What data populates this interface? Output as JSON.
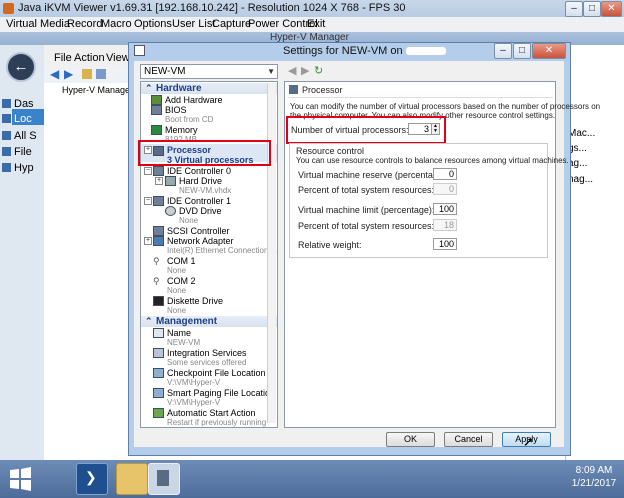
{
  "kvm": {
    "title": "Java iKVM Viewer v1.69.31 [192.168.10.242]  - Resolution 1024 X 768 - FPS 30",
    "menu": [
      "Virtual Media",
      "Record",
      "Macro",
      "Options",
      "User List",
      "Capture",
      "Power Control",
      "Exit"
    ]
  },
  "hyperv": {
    "title": "Hyper-V Manager",
    "menu": [
      "File",
      "Action",
      "View"
    ],
    "tree": [
      "Das",
      "Loc",
      "All S",
      "File",
      "Hyp"
    ],
    "pane_label": "Hyper-V Manager",
    "right_items": [
      "Mac...",
      "gs...",
      "ag...",
      "nag..."
    ]
  },
  "dialog": {
    "title": "Settings for NEW-VM on",
    "vm_selector": "NEW-VM",
    "hardware_header": "Hardware",
    "management_header": "Management",
    "hardware_items": [
      {
        "label": "Add Hardware",
        "sub": ""
      },
      {
        "label": "BIOS",
        "sub": "Boot from CD"
      },
      {
        "label": "Memory",
        "sub": "8192 MB"
      },
      {
        "label": "Processor",
        "sub": "3 Virtual processors"
      },
      {
        "label": "IDE Controller 0",
        "sub": ""
      },
      {
        "label": "Hard Drive",
        "sub": "NEW-VM.vhdx"
      },
      {
        "label": "IDE Controller 1",
        "sub": ""
      },
      {
        "label": "DVD Drive",
        "sub": "None"
      },
      {
        "label": "SCSI Controller",
        "sub": ""
      },
      {
        "label": "Network Adapter",
        "sub": "Intel(R) Ethernet Connection X..."
      },
      {
        "label": "COM 1",
        "sub": "None"
      },
      {
        "label": "COM 2",
        "sub": "None"
      },
      {
        "label": "Diskette Drive",
        "sub": "None"
      }
    ],
    "management_items": [
      {
        "label": "Name",
        "sub": "NEW-VM"
      },
      {
        "label": "Integration Services",
        "sub": "Some services offered"
      },
      {
        "label": "Checkpoint File Location",
        "sub": "V:\\VM\\Hyper-V"
      },
      {
        "label": "Smart Paging File Location",
        "sub": "V:\\VM\\Hyper-V"
      },
      {
        "label": "Automatic Start Action",
        "sub": "Restart if previously running"
      }
    ],
    "panel": {
      "heading": "Processor",
      "desc1": "You can modify the number of virtual processors based on the number of processors on",
      "desc2": "the physical computer. You can also modify other resource control settings.",
      "num_label": "Number of virtual processors:",
      "num_value": "3",
      "rc_title": "Resource control",
      "rc_desc": "You can use resource controls to balance resources among virtual machines.",
      "reserve_label": "Virtual machine reserve (percentage):",
      "reserve_value": "0",
      "reserve_pct_label": "Percent of total system resources:",
      "reserve_pct_value": "0",
      "limit_label": "Virtual machine limit (percentage):",
      "limit_value": "100",
      "limit_pct_label": "Percent of total system resources:",
      "limit_pct_value": "18",
      "weight_label": "Relative weight:",
      "weight_value": "100"
    },
    "buttons": {
      "ok": "OK",
      "cancel": "Cancel",
      "apply": "Apply"
    }
  },
  "taskbar": {
    "time": "8:09 AM",
    "date": "1/21/2017"
  },
  "colors": {
    "highlight_red": "#e0001a",
    "dialog_frame": "#b3cdea",
    "taskbar": "#5a78a6"
  }
}
